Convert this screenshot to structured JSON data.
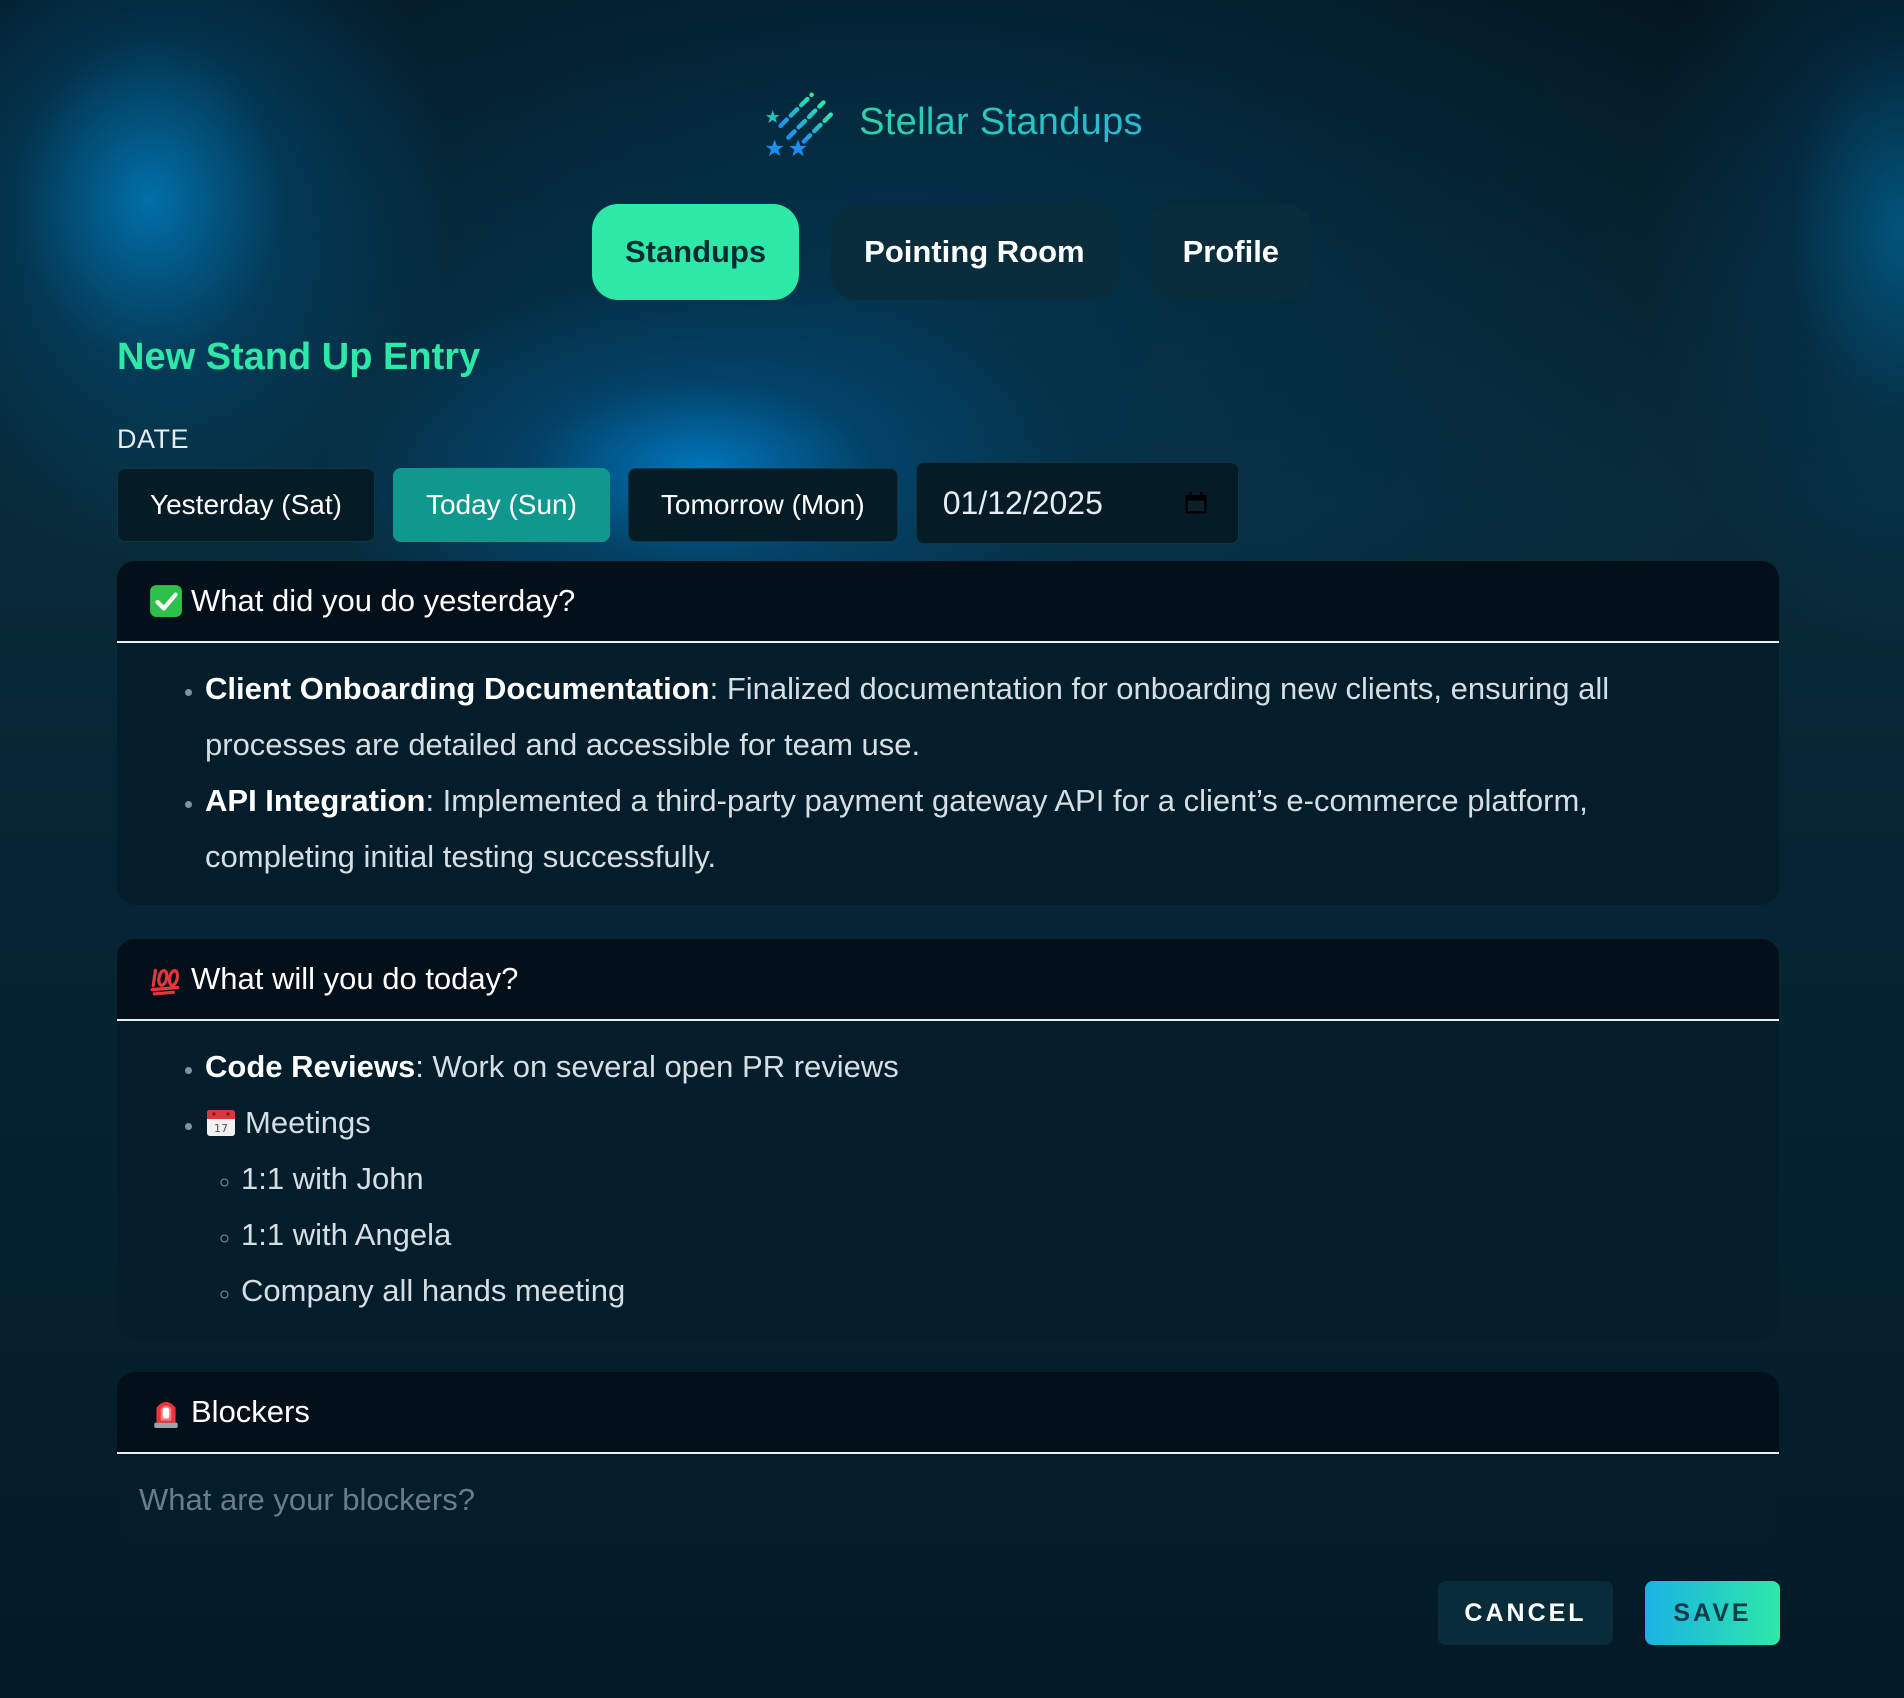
{
  "app": {
    "name": "Stellar Standups",
    "logo_icon": "shooting-stars-icon"
  },
  "nav": {
    "tabs": [
      {
        "label": "Standups",
        "active": true
      },
      {
        "label": "Pointing Room",
        "active": false
      },
      {
        "label": "Profile",
        "active": false
      }
    ]
  },
  "page": {
    "title": "New Stand Up Entry"
  },
  "date": {
    "label": "DATE",
    "options": [
      {
        "label": "Yesterday (Sat)",
        "active": false
      },
      {
        "label": "Today (Sun)",
        "active": true
      },
      {
        "label": "Tomorrow (Mon)",
        "active": false
      }
    ],
    "value": "01/12/2025",
    "icon": "calendar-icon"
  },
  "yesterday": {
    "icon": "check-mark-emoji",
    "title": "What did you do yesterday?",
    "items": [
      {
        "bold": "Client Onboarding Documentation",
        "text": ": Finalized documentation for onboarding new clients, ensuring all processes are detailed and accessible for team use."
      },
      {
        "bold": "API Integration",
        "text": ": Implemented a third-party payment gateway API for a client’s e-commerce platform, completing initial testing successfully."
      }
    ]
  },
  "today": {
    "icon": "hundred-points-emoji",
    "title": "What will you do today?",
    "items": [
      {
        "bold": "Code Reviews",
        "text": ": Work on several open PR reviews"
      },
      {
        "icon": "calendar-emoji",
        "text": "Meetings",
        "subitems": [
          "1:1 with John",
          "1:1 with Angela",
          "Company all hands meeting"
        ]
      }
    ]
  },
  "blockers": {
    "icon": "police-light-emoji",
    "title": "Blockers",
    "placeholder": "What are your blockers?",
    "value": ""
  },
  "actions": {
    "cancel_label": "CANCEL",
    "save_label": "SAVE"
  },
  "colors": {
    "accent": "#2ee8a8",
    "active_date": "#11988e",
    "save_gradient_start": "#1ab2e6",
    "save_gradient_end": "#2ee8a8"
  }
}
